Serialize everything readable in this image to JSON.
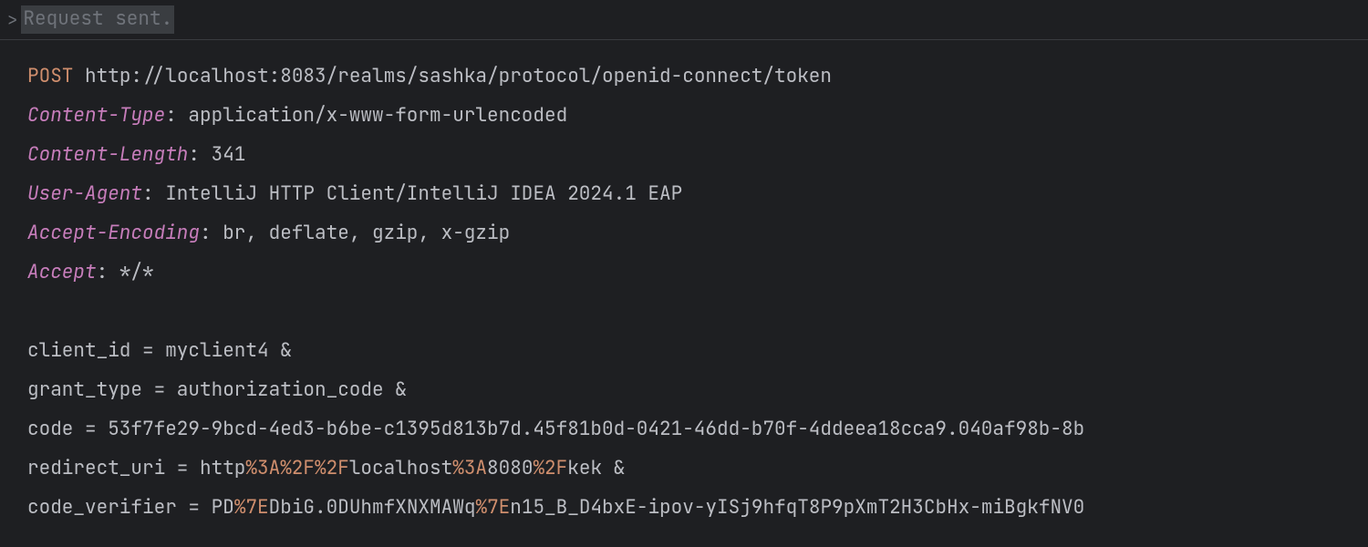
{
  "topbar": {
    "chevron": ">",
    "status": "Request sent."
  },
  "request": {
    "method": "POST",
    "url": "http://localhost:8083/realms/sashka/protocol/openid-connect/token"
  },
  "headers": [
    {
      "name": "Content-Type",
      "value": "application/x-www-form-urlencoded"
    },
    {
      "name": "Content-Length",
      "value": "341"
    },
    {
      "name": "User-Agent",
      "value": "IntelliJ HTTP Client/IntelliJ IDEA 2024.1 EAP"
    },
    {
      "name": "Accept-Encoding",
      "value": "br, deflate, gzip, x-gzip"
    },
    {
      "name": "Accept",
      "value": "*/*"
    }
  ],
  "body": [
    {
      "segments": [
        {
          "t": "client_id = myclient4 &",
          "esc": false
        }
      ]
    },
    {
      "segments": [
        {
          "t": "grant_type = authorization_code &",
          "esc": false
        }
      ]
    },
    {
      "segments": [
        {
          "t": "code = 53f7fe29-9bcd-4ed3-b6be-c1395d813b7d.45f81b0d-0421-46dd-b70f-4ddeea18cca9.040af98b-8b",
          "esc": false
        }
      ]
    },
    {
      "segments": [
        {
          "t": "redirect_uri = http",
          "esc": false
        },
        {
          "t": "%3A%2F%2F",
          "esc": true
        },
        {
          "t": "localhost",
          "esc": false
        },
        {
          "t": "%3A",
          "esc": true
        },
        {
          "t": "8080",
          "esc": false
        },
        {
          "t": "%2F",
          "esc": true
        },
        {
          "t": "kek &",
          "esc": false
        }
      ]
    },
    {
      "segments": [
        {
          "t": "code_verifier = PD",
          "esc": false
        },
        {
          "t": "%7E",
          "esc": true
        },
        {
          "t": "DbiG.0DUhmfXNXMAWq",
          "esc": false
        },
        {
          "t": "%7E",
          "esc": true
        },
        {
          "t": "n15_B_D4bxE-ipov-yISj9hfqT8P9pXmT2H3CbHx-miBgkfNV0",
          "esc": false
        }
      ]
    }
  ]
}
